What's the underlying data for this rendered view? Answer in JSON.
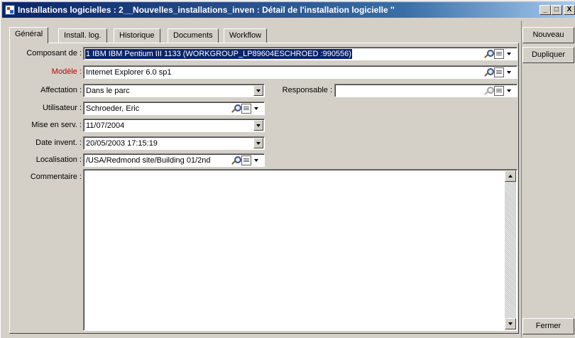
{
  "window": {
    "title": "Installations logicielles : 2__Nouvelles_installations_inven : Détail de l'installation logicielle ''",
    "controls": {
      "minimize": "_",
      "maximize": "□",
      "close": "X"
    }
  },
  "tabs": [
    {
      "label": "Général",
      "active": true
    },
    {
      "label": "Install. log."
    },
    {
      "label": "Historique"
    },
    {
      "label": "Documents"
    },
    {
      "label": "Workflow"
    }
  ],
  "form": {
    "composant": {
      "label": "Composant de :",
      "value": "1 IBM IBM Pentium III 1133 (WORKGROUP_LP89604ESCHROED :990556)"
    },
    "modele": {
      "label": "Modèle :",
      "value": "Internet Explorer  6.0 sp1",
      "label_color": "#c00000"
    },
    "affectation": {
      "label": "Affectation :",
      "value": "Dans le parc"
    },
    "responsable": {
      "label": "Responsable :",
      "value": ""
    },
    "utilisateur": {
      "label": "Utilisateur :",
      "value": "Schroeder, Eric"
    },
    "mise_en_serv": {
      "label": "Mise en serv. :",
      "value": "11/07/2004"
    },
    "date_invent": {
      "label": "Date invent. :",
      "value": "20/05/2003 17:15:19"
    },
    "localisation": {
      "label": "Localisation :",
      "value": "/USA/Redmond site/Building 01/2nd"
    },
    "commentaire": {
      "label": "Commentaire :",
      "value": ""
    }
  },
  "buttons": {
    "nouveau": "Nouveau",
    "dupliquer": "Dupliquer",
    "fermer": "Fermer"
  },
  "icons": {
    "zoom": "magnifier-icon",
    "detail": "detail-list-icon",
    "dropdown": "chevron-down-icon"
  },
  "colors": {
    "selection": "#0a246a",
    "title_bar": "#0a246a",
    "required_label": "#c00000"
  }
}
